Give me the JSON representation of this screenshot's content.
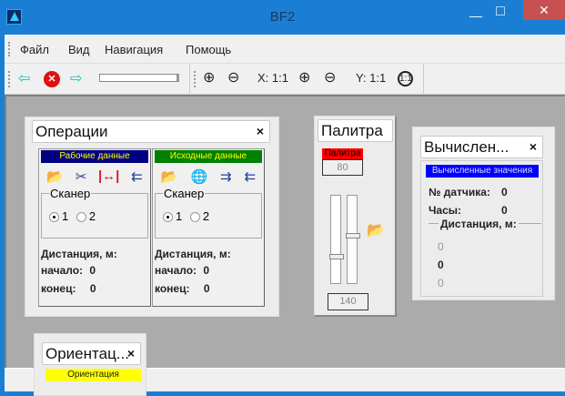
{
  "window": {
    "title": "BF2",
    "minimize": "—",
    "maximize": "□",
    "close": "✕"
  },
  "menu": [
    "Файл",
    "Вид",
    "Навигация",
    "Помощь"
  ],
  "toolbar": {
    "x_scale": "X: 1:1",
    "y_scale": "Y: 1:1"
  },
  "operations": {
    "title": "Операции",
    "close": "×",
    "work": {
      "header": "Рабочие данные",
      "scanner": "Сканер",
      "r1": "1",
      "r2": "2",
      "distance": "Дистанция, м:",
      "start_label": "начало:",
      "start": "0",
      "end_label": "конец:",
      "end": "0"
    },
    "source": {
      "header": "Исходные данные",
      "scanner": "Сканер",
      "r1": "1",
      "r2": "2",
      "distance": "Дистанция, м:",
      "start_label": "начало:",
      "start": "0",
      "end_label": "конец:",
      "end": "0"
    }
  },
  "palette": {
    "title": "Палитра",
    "label": "Палитра",
    "top_value": "80",
    "bottom_value": "140"
  },
  "computed": {
    "title": "Вычислен...",
    "close": "×",
    "header": "Вычисленные значения",
    "sensor_label": "№ датчика:",
    "sensor": "0",
    "hours_label": "Часы:",
    "hours": "0",
    "distance": "Дистанция, м:",
    "d1": "0",
    "d2": "0",
    "d3": "0"
  },
  "orientation": {
    "title": "Ориентац...",
    "close": "×",
    "header": "Ориентация"
  },
  "colors": {
    "titlebar": "#1a7fd4",
    "work_band": "#000080",
    "source_band": "#008000",
    "palette_band": "#ff0000",
    "computed_band": "#0000ff",
    "orientation_band": "#ffff00"
  }
}
